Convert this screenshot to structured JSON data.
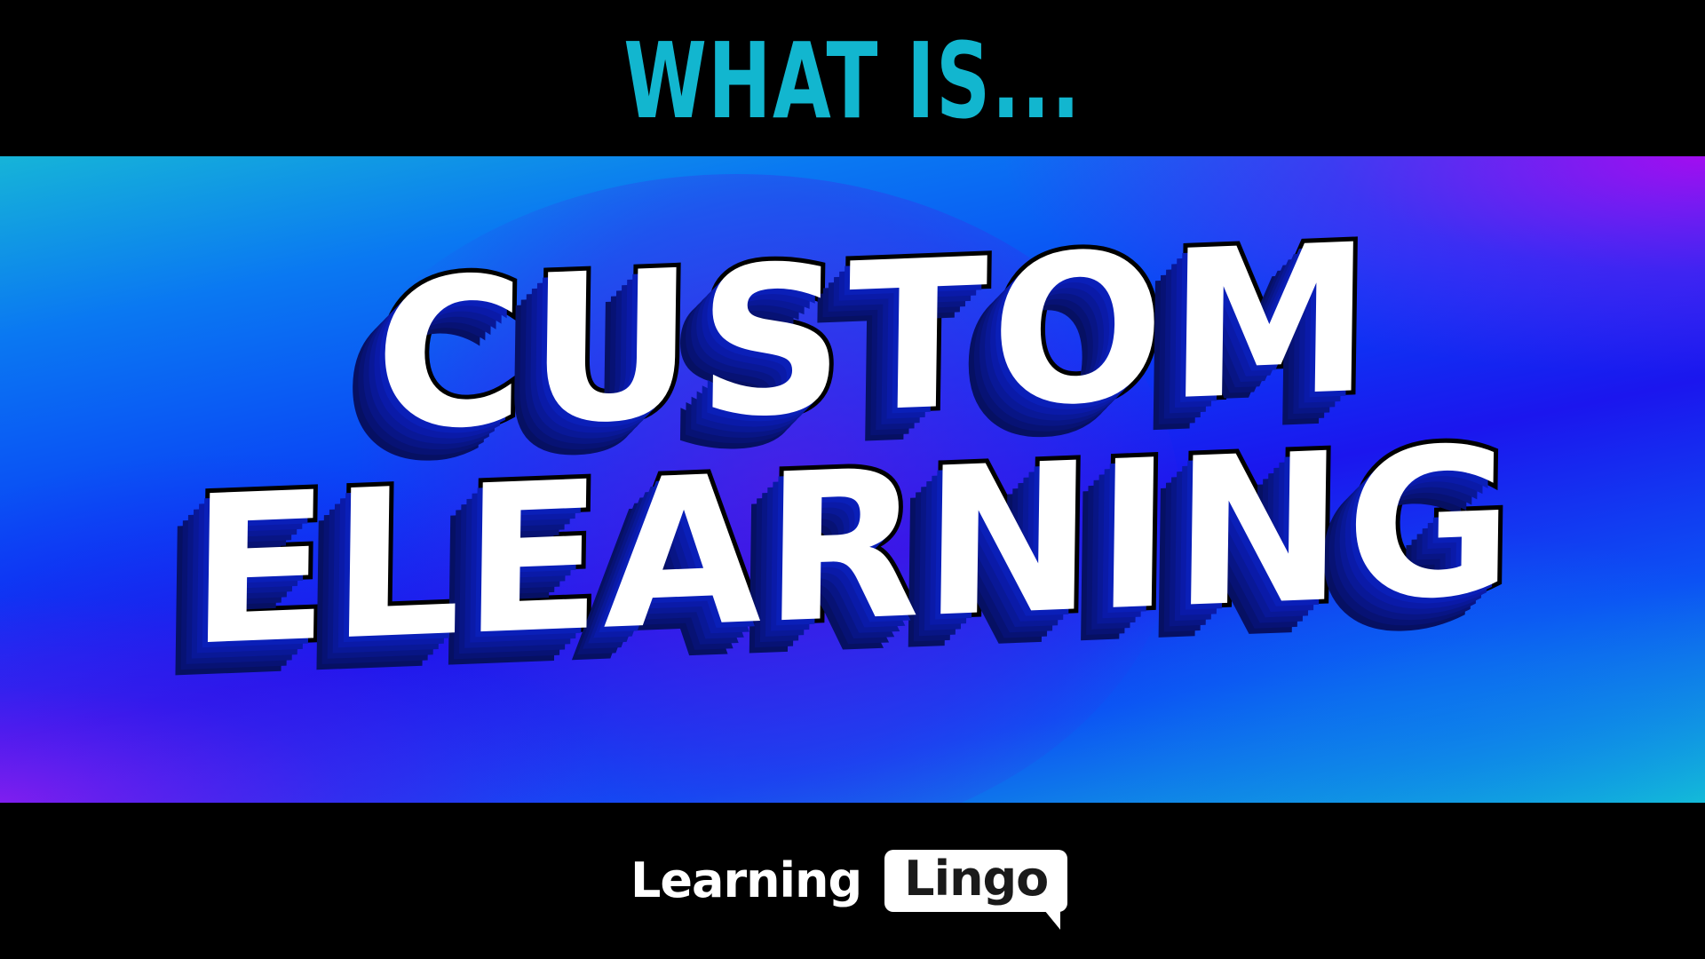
{
  "header": {
    "eyebrow": "WHAT IS..."
  },
  "headline": {
    "line_1": "CUSTOM",
    "line_2": "ELEARNING"
  },
  "brand": {
    "word_1": "Learning",
    "word_2": "Lingo"
  },
  "colors": {
    "background": "#000000",
    "eyebrow": "#12b6cf",
    "headline_fill": "#ffffff",
    "headline_outline": "#000000",
    "headline_shadow": "#0a1aa8",
    "gradient_start": "#16b4d8",
    "gradient_mid": "#1b16ee",
    "gradient_accent": "#aa0af0",
    "logo_text": "#ffffff",
    "logo_bubble": "#ffffff",
    "logo_bubble_text": "#1a1a1a"
  },
  "icons": {
    "logo_bubble": "speech-bubble-icon"
  }
}
